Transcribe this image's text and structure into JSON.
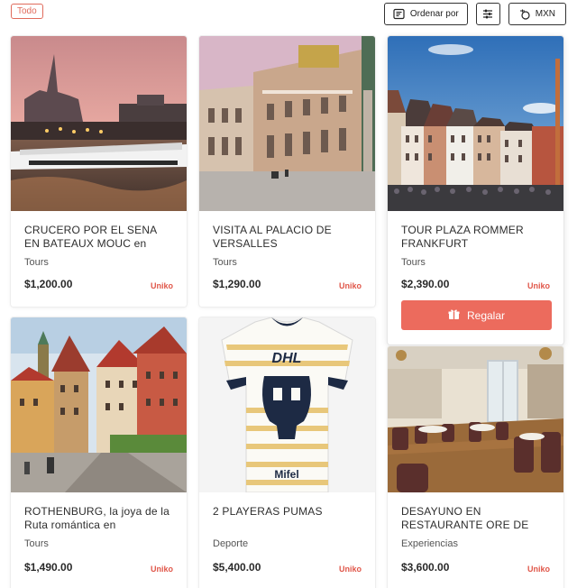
{
  "filter_chip": "Todo",
  "toolbar": {
    "sort_label": "Ordenar por",
    "currency_label": "MXN",
    "icons": [
      "sort-icon",
      "filter-sliders-icon",
      "currency-icon"
    ]
  },
  "products": [
    {
      "title": "CRUCERO POR EL SENA EN BATEAUX MOUC en",
      "category": "Tours",
      "price": "$1,200.00",
      "brand": "Uniko",
      "image": "seine-cruise-photo"
    },
    {
      "title": "VISITA AL PALACIO DE VERSALLES",
      "category": "Tours",
      "price": "$1,290.00",
      "brand": "Uniko",
      "image": "versailles-palace-photo"
    },
    {
      "title": "TOUR PLAZA ROMMER FRANKFURT",
      "category": "Tours",
      "price": "$2,390.00",
      "brand": "Uniko",
      "image": "frankfurt-romer-photo",
      "gift_label": "Regalar"
    },
    {
      "title": "ROTHENBURG, la joya de la Ruta romántica en",
      "category": "Tours",
      "price": "$1,490.00",
      "brand": "Uniko",
      "image": "rothenburg-street-photo"
    },
    {
      "title": "2 PLAYERAS PUMAS",
      "category": "Deporte",
      "price": "$5,400.00",
      "brand": "Uniko",
      "image": "pumas-jersey-photo"
    },
    {
      "title": "DESAYUNO EN RESTAURANTE ORE DE",
      "category": "Experiencias",
      "price": "$3,600.00",
      "brand": "Uniko",
      "image": "restaurant-interior-photo"
    }
  ],
  "colors": {
    "accent": "#ec6b5d",
    "brand_text": "#e0574a"
  }
}
